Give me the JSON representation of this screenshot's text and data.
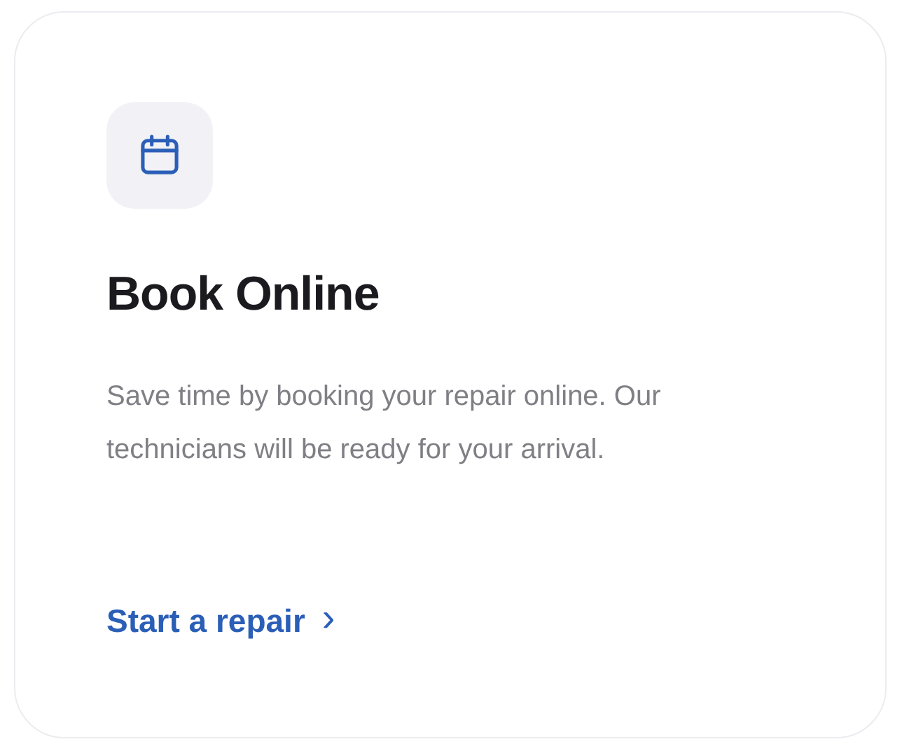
{
  "card": {
    "title": "Book Online",
    "description": "Save time by booking your repair online. Our technicians will be ready for your arrival.",
    "link": {
      "label": "Start a repair",
      "arrow": "›"
    }
  }
}
